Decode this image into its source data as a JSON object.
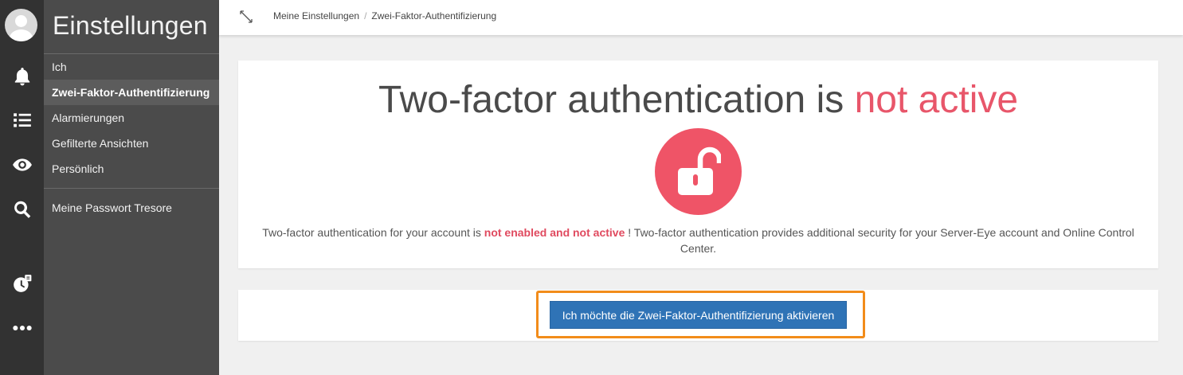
{
  "sidebar": {
    "title": "Einstellungen",
    "items": [
      {
        "label": "Ich"
      },
      {
        "label": "Zwei-Faktor-Authentifizierung"
      },
      {
        "label": "Alarmierungen"
      },
      {
        "label": "Gefilterte Ansichten"
      },
      {
        "label": "Persönlich"
      },
      {
        "label": "Meine Passwort Tresore"
      }
    ],
    "active_index": 1
  },
  "iconbar": {
    "icons": [
      "user-avatar-icon",
      "bell-icon",
      "list-icon",
      "eye-icon",
      "search-icon",
      "clock-badge-icon",
      "more-dots-icon"
    ]
  },
  "breadcrumb": {
    "items": [
      "Meine Einstellungen",
      "Zwei-Faktor-Authentifizierung"
    ],
    "separator": "/"
  },
  "status": {
    "headline_prefix": "Two-factor authentication is",
    "headline_state": "not active",
    "description_prefix": "Two-factor authentication for your account is",
    "description_state": "not enabled and not active",
    "description_suffix": "! Two-factor authentication provides additional security for your Server-Eye account and Online Control Center."
  },
  "action": {
    "activate_label": "Ich möchte die Zwei-Faktor-Authentifizierung aktivieren"
  },
  "colors": {
    "danger": "#e8566a",
    "primary_button": "#2f73b6",
    "highlight": "#f28c1a"
  }
}
